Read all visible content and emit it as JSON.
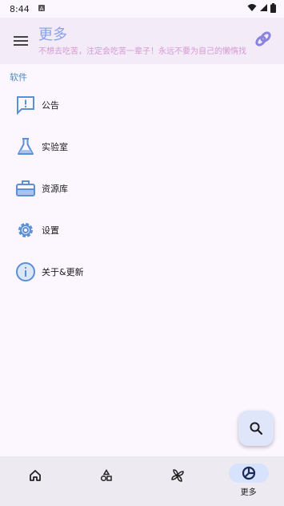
{
  "status_bar": {
    "time": "8:44",
    "notification_icon": "notification-icon",
    "icons": [
      "wifi-icon",
      "signal-icon",
      "battery-icon"
    ]
  },
  "app_bar": {
    "title": "更多",
    "subtitle": "不想去吃苦，注定会吃苦一辈子！永远不要为自己的懒惰找借口",
    "menu_icon": "menu-icon",
    "action_icon": "link-icon"
  },
  "section": {
    "label": "软件"
  },
  "menu_items": [
    {
      "label": "公告",
      "icon": "announcement-icon"
    },
    {
      "label": "实验室",
      "icon": "flask-icon"
    },
    {
      "label": "资源库",
      "icon": "toolbox-icon"
    },
    {
      "label": "设置",
      "icon": "settings-icon"
    },
    {
      "label": "关于&更新",
      "icon": "info-icon"
    }
  ],
  "fab": {
    "icon": "search-icon"
  },
  "bottom_nav": {
    "items": [
      {
        "icon": "home-icon",
        "label": ""
      },
      {
        "icon": "shapes-icon",
        "label": ""
      },
      {
        "icon": "pinwheel-icon",
        "label": ""
      },
      {
        "icon": "pie-chart-icon",
        "label": "更多"
      }
    ]
  },
  "colors": {
    "accent": "#4b89c6",
    "title": "#8aa0ea",
    "subtitle": "#d59ad0",
    "nav_active": "#d7e2fc"
  }
}
